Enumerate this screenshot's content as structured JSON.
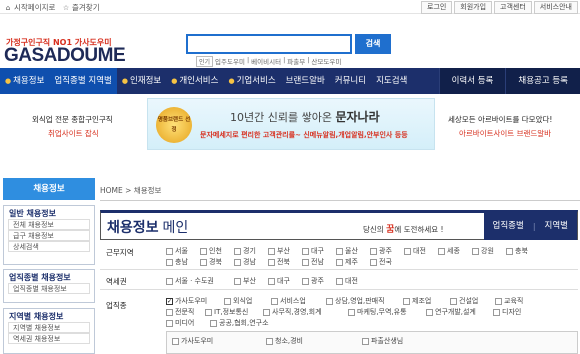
{
  "topbar": {
    "homepage_label": "시작페이지로",
    "favorite_label": "즐겨찾기",
    "links": [
      "로그인",
      "회원가입",
      "고객센터",
      "서비스안내"
    ]
  },
  "header": {
    "tagline": "가정구인구직 NO1 가사도우미",
    "logo": "GASADOUME",
    "search_placeholder": "",
    "search_button": "검색",
    "popular_badge": "인기",
    "popular_terms": [
      "입주도우미",
      "베이비시터",
      "파출부",
      "산모도우미"
    ]
  },
  "nav": {
    "items": [
      "채용정보",
      "업직종별 지역별",
      "인재정보",
      "개인서비스",
      "기업서비스",
      "브랜드알바",
      "커뮤니티",
      "지도검색"
    ],
    "right_items": [
      "이력서 등록",
      "채용공고 등록"
    ]
  },
  "banner": {
    "left_line1": "외식업 전문 종합구인구직",
    "left_line2": "취업사이트 잡식",
    "emblem_text": "명품브랜드 선정",
    "headline_prefix": "10년간 신뢰를 쌓아온",
    "headline_brand": "문자나라",
    "subline": "문자메세지로 편리한 고객관리를~ 신메뉴알림,개업알림,안부인사 등등",
    "right_line1": "세상모든 아르바이트를 다모았다!",
    "right_line2": "아르바이트사이트 브랜드알바"
  },
  "breadcrumb": "HOME > 채용정보",
  "sidebar": {
    "header": "채용정보",
    "sections": [
      {
        "title": "일반 채용정보",
        "items": [
          "전체 채용정보",
          "급구 채용정보",
          "상세검색"
        ]
      },
      {
        "title": "업직종별 채용정보",
        "items": [
          "업직종별 채용정보"
        ]
      },
      {
        "title": "지역별 채용정보",
        "items": [
          "지역별 채용정보",
          "역세권 채용정보"
        ]
      }
    ]
  },
  "main": {
    "title": "채용정보",
    "title_suffix": "메인",
    "slogan_prefix": "당신의",
    "slogan_highlight": "꿈",
    "slogan_suffix": "에 도전하세요 !",
    "tabs": [
      "업직종별",
      "지역별"
    ],
    "region_label": "근무지역",
    "regions_row1": [
      "서울",
      "인천",
      "경기",
      "부산",
      "대구",
      "울산",
      "광주",
      "대전",
      "세종",
      "강원",
      "충북"
    ],
    "regions_row2": [
      "충남",
      "경북",
      "경남",
      "전북",
      "전남",
      "제주",
      "전국"
    ],
    "station_label": "역세권",
    "stations": [
      "서울 · 수도권",
      "부산",
      "대구",
      "광주",
      "대전"
    ],
    "job_label": "업직종",
    "jobs_row1": [
      "가사도우미",
      "외식업",
      "서비스업",
      "상담,영업,판매직",
      "제조업",
      "건설업",
      "교육직"
    ],
    "jobs_row2": [
      "전문직",
      "IT,정보통신",
      "사무직,경영,회계",
      "마케팅,무역,유통",
      "연구개발,설계",
      "디자인"
    ],
    "jobs_row3": [
      "미디어",
      "공공,협회,연구소"
    ],
    "sub_jobs": [
      "가사도우미",
      "청소,경비",
      "파출산생님"
    ]
  }
}
